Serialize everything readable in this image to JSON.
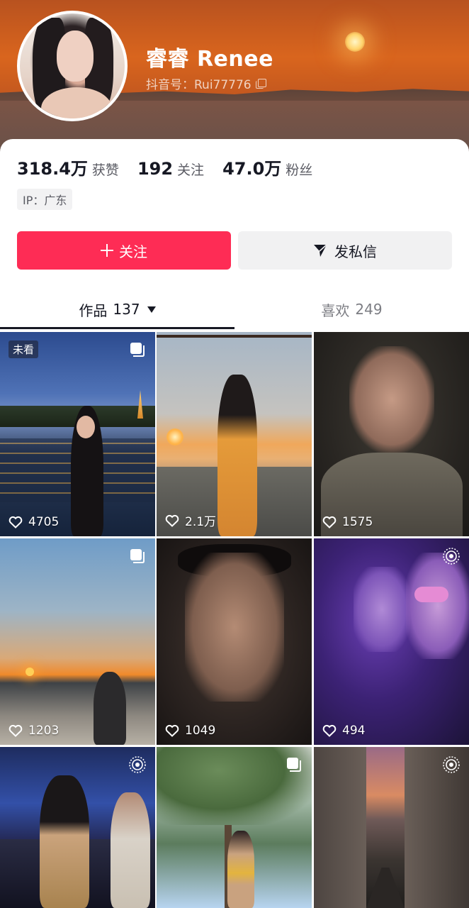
{
  "profile": {
    "name": "睿睿 Renee",
    "douyin_id": "抖音号：Rui77776"
  },
  "stats": [
    {
      "value": "318.4万",
      "label": "获赞"
    },
    {
      "value": "192",
      "label": "关注"
    },
    {
      "value": "47.0万",
      "label": "粉丝"
    }
  ],
  "ip_location": "IP：广东",
  "buttons": {
    "follow": "关注",
    "message": "发私信"
  },
  "tabs": {
    "works_label": "作品",
    "works_count": "137",
    "likes_label": "喜欢",
    "likes_count": "249"
  },
  "colors": {
    "accent": "#fe2c55",
    "text_primary": "#161823",
    "text_secondary": "#5a5b63"
  },
  "grid": {
    "unseen_badge": "未看",
    "items": [
      {
        "likes": "4705",
        "overlay_icon": "album-icon"
      },
      {
        "likes": "2.1万",
        "overlay_icon": ""
      },
      {
        "likes": "1575",
        "overlay_icon": ""
      },
      {
        "likes": "1203",
        "overlay_icon": "album-icon"
      },
      {
        "likes": "1049",
        "overlay_icon": ""
      },
      {
        "likes": "494",
        "overlay_icon": "live-photo-icon"
      },
      {
        "likes": "",
        "overlay_icon": "live-photo-icon"
      },
      {
        "likes": "",
        "overlay_icon": "album-icon"
      },
      {
        "likes": "",
        "overlay_icon": "live-photo-icon"
      }
    ]
  }
}
